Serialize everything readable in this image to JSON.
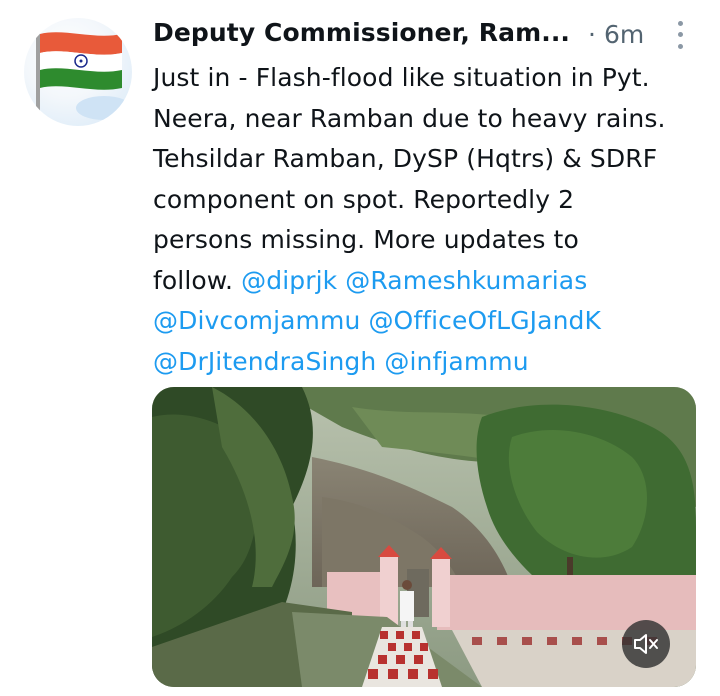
{
  "tweet": {
    "author_name": "Deputy Commissioner, Ram...",
    "separator": "·",
    "time_ago": "6m",
    "text_lines": [
      "Just in - Flash-flood like situation in Pyt.",
      "Neera, near Ramban due to heavy rains.",
      "Tehsildar Ramban, DySP (Hqtrs) & SDRF",
      "component on spot. Reportedly 2",
      "persons missing. More updates to",
      "follow. "
    ],
    "mentions": [
      "@diprjk",
      "@Rameshkumarias",
      "@Divcomjammu",
      "@OfficeOfLGJandK",
      "@DrJitendraSingh",
      "@infjammu"
    ]
  },
  "icons": {
    "avatar": "india-flag-avatar",
    "more": "more-options-icon",
    "mute": "volume-muted-icon"
  },
  "colors": {
    "text": "#0f1419",
    "muted": "#536471",
    "mention": "#1d9bf0",
    "flag_saffron": "#e85a3a",
    "flag_green": "#2e8b2e",
    "chakra": "#1b2a8c"
  }
}
